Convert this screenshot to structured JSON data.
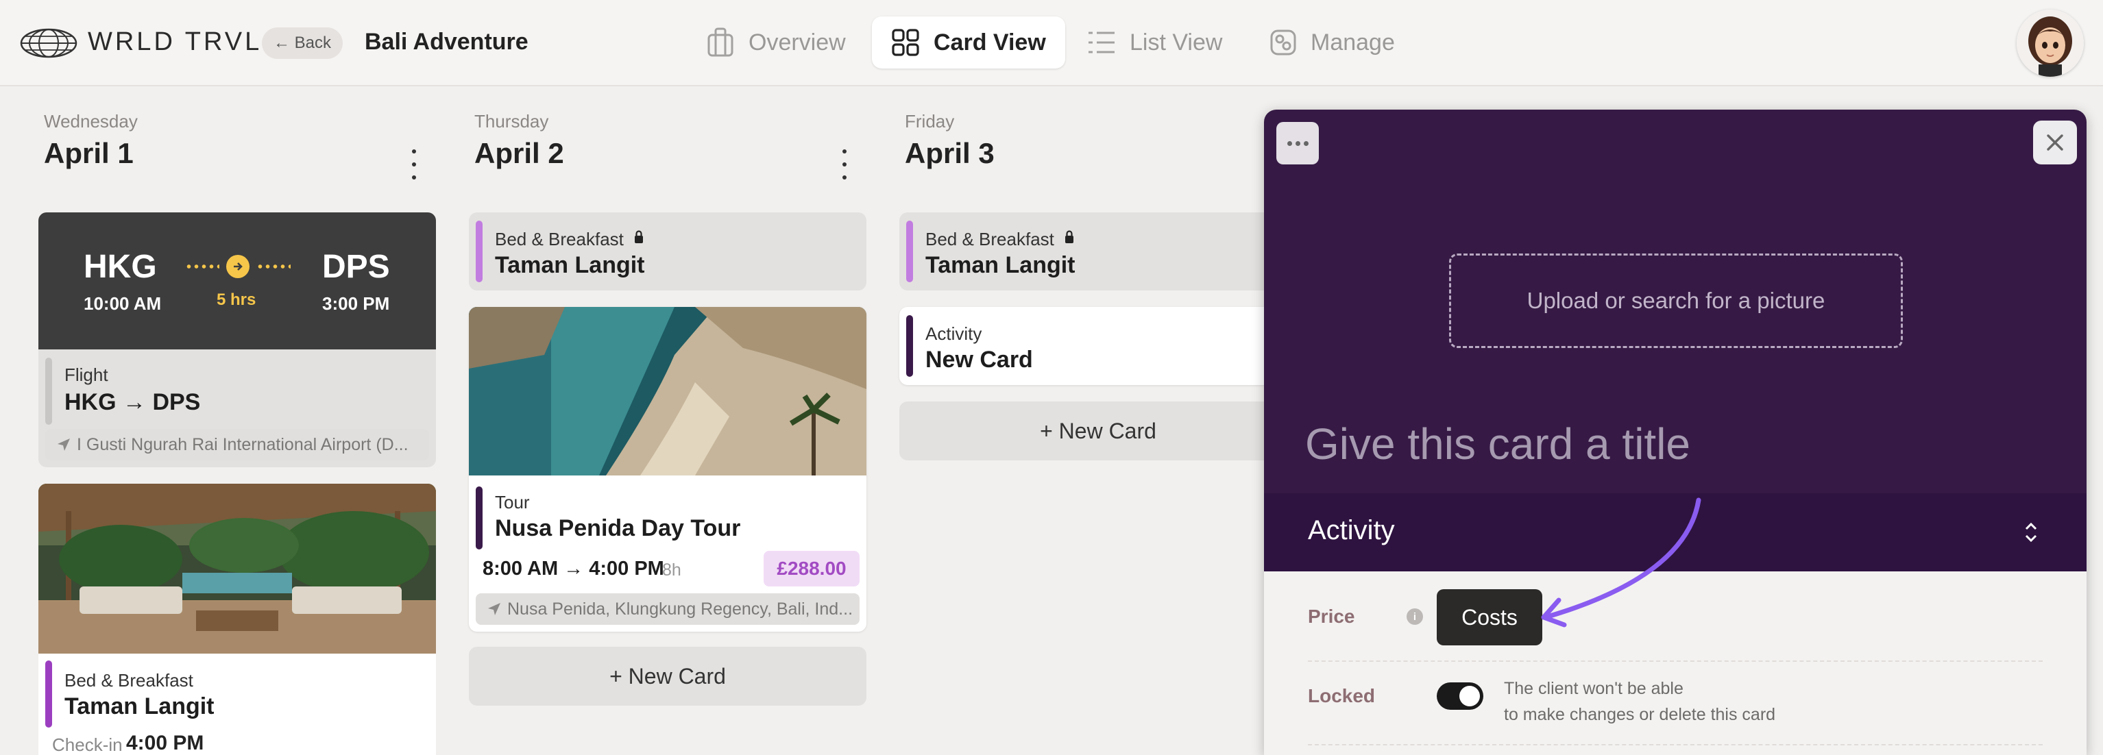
{
  "header": {
    "brand": "WRLD TRVL",
    "back_label": "← Back",
    "trip_title": "Bali Adventure",
    "tabs": [
      {
        "label": "Overview",
        "icon": "bag-icon",
        "active": false
      },
      {
        "label": "Card View",
        "icon": "grid-icon",
        "active": true
      },
      {
        "label": "List View",
        "icon": "list-icon",
        "active": false
      },
      {
        "label": "Manage",
        "icon": "manage-icon",
        "active": false
      }
    ]
  },
  "days": [
    {
      "weekday": "Wednesday",
      "date": "April 1",
      "flight": {
        "from_code": "HKG",
        "from_time": "10:00 AM",
        "to_code": "DPS",
        "to_time": "3:00 PM",
        "duration": "5 hrs",
        "type": "Flight",
        "title": "HKG → DPS",
        "location": "I Gusti Ngurah Rai International Airport (D..."
      },
      "stay": {
        "type": "Bed & Breakfast",
        "title": "Taman Langit",
        "checkin_label": "Check-in",
        "checkin_time": "4:00 PM"
      }
    },
    {
      "weekday": "Thursday",
      "date": "April 2",
      "stay": {
        "type": "Bed & Breakfast",
        "title": "Taman Langit"
      },
      "tour": {
        "type": "Tour",
        "title": "Nusa Penida Day Tour",
        "times": "8:00 AM → 4:00 PM",
        "hours": "8h",
        "price": "£288.00",
        "location": "Nusa Penida, Klungkung Regency, Bali, Ind..."
      },
      "new_card": "+ New Card"
    },
    {
      "weekday": "Friday",
      "date": "April 3",
      "stay": {
        "type": "Bed & Breakfast",
        "title": "Taman Langit"
      },
      "activity": {
        "type": "Activity",
        "title": "New Card"
      },
      "new_card": "+ New Card"
    }
  ],
  "panel": {
    "upload_text": "Upload or search for a picture",
    "title_placeholder": "Give this card a title",
    "type_value": "Activity",
    "price_label": "Price",
    "costs_button": "Costs",
    "locked_label": "Locked",
    "locked_on": true,
    "locked_note_1": "The client won't be able",
    "locked_note_2": "to make changes or delete this card"
  },
  "colors": {
    "panel_bg": "#361a45",
    "accent_purple": "#a24bc3",
    "flight_bg": "#3d3d3d",
    "flight_accent": "#f6c64a",
    "annotation_arrow": "#8a5cf0"
  }
}
